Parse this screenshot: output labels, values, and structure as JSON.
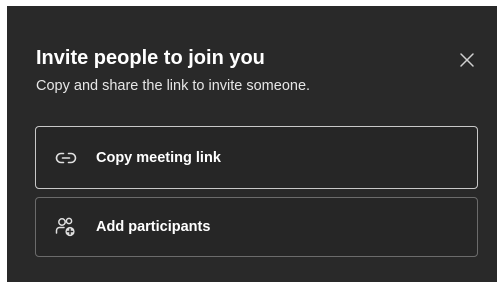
{
  "dialog": {
    "title": "Invite people to join you",
    "subtitle": "Copy and share the link to invite someone.",
    "close_icon": "close-icon"
  },
  "options": [
    {
      "label": "Copy meeting link",
      "icon": "link-icon"
    },
    {
      "label": "Add participants",
      "icon": "add-people-icon"
    }
  ],
  "colors": {
    "dialog_background": "#292929",
    "option_border_focused": "#c8c8c8",
    "option_border": "#6b6b6b",
    "text": "#ffffff"
  }
}
